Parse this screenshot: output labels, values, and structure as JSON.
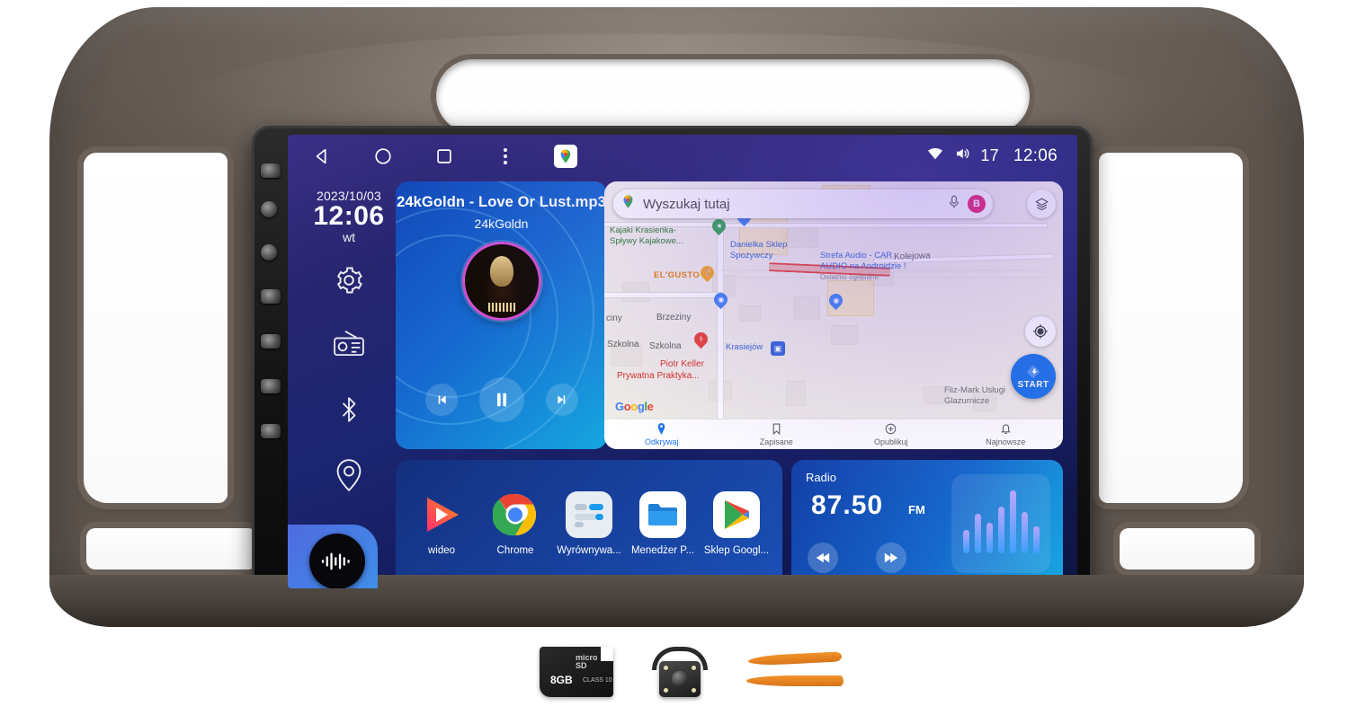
{
  "device": {
    "type": "android-car-head-unit",
    "fascia_color": "#6b6159"
  },
  "statusbar": {
    "nav": [
      {
        "name": "back-icon",
        "label": "Back"
      },
      {
        "name": "home-icon",
        "label": "Home"
      },
      {
        "name": "recents-icon",
        "label": "Recents"
      },
      {
        "name": "overflow-menu-icon",
        "label": "More"
      },
      {
        "name": "google-maps-icon",
        "label": "Maps"
      }
    ],
    "wifi_icon": "wifi-icon",
    "volume_icon": "volume-icon",
    "volume_value": "17",
    "clock": "12:06"
  },
  "rail": {
    "date": "2023/10/03",
    "time": "12:06",
    "day_of_week": "wt",
    "items": [
      {
        "name": "settings-icon",
        "label": "Settings"
      },
      {
        "name": "radio-icon",
        "label": "Radio"
      },
      {
        "name": "bluetooth-icon",
        "label": "Bluetooth"
      },
      {
        "name": "location-pin-icon",
        "label": "Navigation"
      }
    ],
    "fab": {
      "name": "voice-assistant-icon",
      "label": "Voice"
    }
  },
  "music": {
    "title": "24kGoldn - Love Or Lust.mp3",
    "artist": "24kGoldn",
    "album_art": "album-art",
    "controls": [
      {
        "name": "previous-track-button",
        "label": "Previous"
      },
      {
        "name": "pause-button",
        "label": "Pause"
      },
      {
        "name": "next-track-button",
        "label": "Next"
      }
    ]
  },
  "map": {
    "search_placeholder": "Wyszukaj tutaj",
    "search_value": "",
    "mic_icon": "microphone-icon",
    "avatar_initial": "B",
    "layers_icon": "layers-icon",
    "locate_icon": "my-location-icon",
    "start_label": "START",
    "watermark": "Google",
    "labels": [
      {
        "text": "Kajaki Krasieńka-",
        "kind": "green"
      },
      {
        "text": "Spływy Kajakowe...",
        "kind": "green"
      },
      {
        "text": "Danielka Sklep",
        "kind": "blue"
      },
      {
        "text": "Spożywczy",
        "kind": "blue"
      },
      {
        "text": "Strefa Audio - CAR",
        "kind": "blue"
      },
      {
        "text": "AUDIO na Androidzie !",
        "kind": "blue"
      },
      {
        "text": "Ostatnio oglądane",
        "kind": "sub"
      },
      {
        "text": "EL'GUSTO",
        "kind": "orange"
      },
      {
        "text": "Brzeziny",
        "kind": "road"
      },
      {
        "text": "ciny",
        "kind": "road"
      },
      {
        "text": "Szkolna",
        "kind": "road"
      },
      {
        "text": "Szkolna",
        "kind": "road"
      },
      {
        "text": "Kolejowa",
        "kind": "road"
      },
      {
        "text": "Krasiejów",
        "kind": "blue"
      },
      {
        "text": "Piotr Keller",
        "kind": "red"
      },
      {
        "text": "Prywatna Praktyka...",
        "kind": "red"
      },
      {
        "text": "Fliz-Mark Usługi",
        "kind": "grey"
      },
      {
        "text": "Glazurnicze",
        "kind": "grey"
      }
    ],
    "bottom_nav": [
      {
        "label": "Odkrywaj",
        "icon": "explore-pin-icon",
        "active": true
      },
      {
        "label": "Zapisane",
        "icon": "bookmark-icon",
        "active": false
      },
      {
        "label": "Opublikuj",
        "icon": "contribute-icon",
        "active": false
      },
      {
        "label": "Najnowsze",
        "icon": "updates-bell-icon",
        "active": false
      }
    ]
  },
  "apps": [
    {
      "label": "wideo",
      "icon": "video-player-icon"
    },
    {
      "label": "Chrome",
      "icon": "chrome-icon"
    },
    {
      "label": "Wyrównywa...",
      "icon": "equalizer-settings-icon"
    },
    {
      "label": "Menedżer P...",
      "icon": "file-manager-icon"
    },
    {
      "label": "Sklep Googl...",
      "icon": "google-play-icon"
    }
  ],
  "radio": {
    "title": "Radio",
    "frequency": "87.50",
    "band": "FM",
    "prev": {
      "name": "radio-seek-down-button",
      "label": "Seek down"
    },
    "next": {
      "name": "radio-seek-up-button",
      "label": "Seek up"
    },
    "equalizer_icon": "equalizer-visualizer-icon",
    "bars": [
      26,
      44,
      34,
      52,
      70,
      46,
      30
    ]
  },
  "accessories": [
    {
      "name": "microsd-card",
      "capacity": "8GB",
      "format": "micro SD"
    },
    {
      "name": "reversing-camera",
      "label": "Rear view camera"
    },
    {
      "name": "pry-tools",
      "label": "Trim removal tools"
    }
  ]
}
